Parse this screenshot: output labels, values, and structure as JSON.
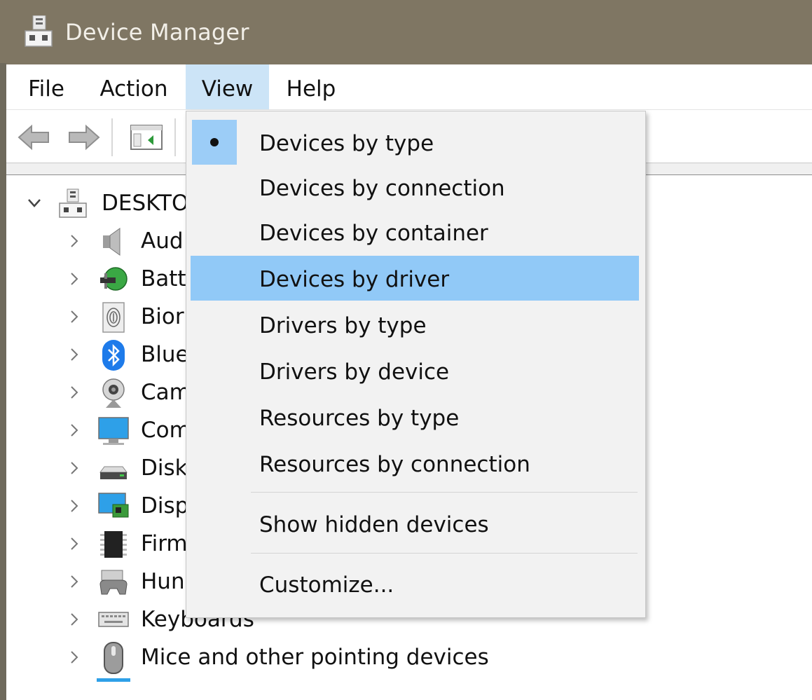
{
  "window": {
    "title": "Device Manager",
    "title_icon": "computer-icon"
  },
  "menubar": {
    "items": [
      {
        "label": "File"
      },
      {
        "label": "Action"
      },
      {
        "label": "View"
      },
      {
        "label": "Help"
      }
    ],
    "active": "View"
  },
  "toolbar": {
    "buttons": [
      "back-arrow-icon",
      "forward-arrow-icon",
      "show-hide-console-tree-icon"
    ]
  },
  "tree": {
    "root": {
      "label": "DESKTO",
      "icon": "computer-icon",
      "expanded": true
    },
    "children": [
      {
        "label": "Aud",
        "icon": "speaker-icon"
      },
      {
        "label": "Batt",
        "icon": "battery-icon"
      },
      {
        "label": "Bior",
        "icon": "fingerprint-icon"
      },
      {
        "label": "Blue",
        "icon": "bluetooth-icon"
      },
      {
        "label": "Cam",
        "icon": "webcam-icon"
      },
      {
        "label": "Com",
        "icon": "monitor-icon"
      },
      {
        "label": "Disk",
        "icon": "disk-drive-icon"
      },
      {
        "label": "Disp",
        "icon": "display-adapter-icon"
      },
      {
        "label": "Firm",
        "icon": "chip-icon"
      },
      {
        "label": "Hun",
        "icon": "hid-icon"
      },
      {
        "label": "Keyboards",
        "icon": "keyboard-icon"
      },
      {
        "label": "Mice and other pointing devices",
        "icon": "mouse-icon"
      }
    ]
  },
  "view_menu": {
    "items": [
      {
        "label": "Devices by type",
        "checked": true
      },
      {
        "label": "Devices by connection"
      },
      {
        "label": "Devices by container"
      },
      {
        "label": "Devices by driver",
        "highlighted": true
      },
      {
        "label": "Drivers by type"
      },
      {
        "label": "Drivers by device"
      },
      {
        "label": "Resources by type"
      },
      {
        "label": "Resources by connection"
      },
      {
        "label": "Show hidden devices"
      },
      {
        "label": "Customize..."
      }
    ]
  },
  "colors": {
    "titlebar": "#7f7663",
    "menu_active": "#cce4f7",
    "menu_highlight": "#91c9f7",
    "dropdown_bg": "#f2f2f2"
  }
}
